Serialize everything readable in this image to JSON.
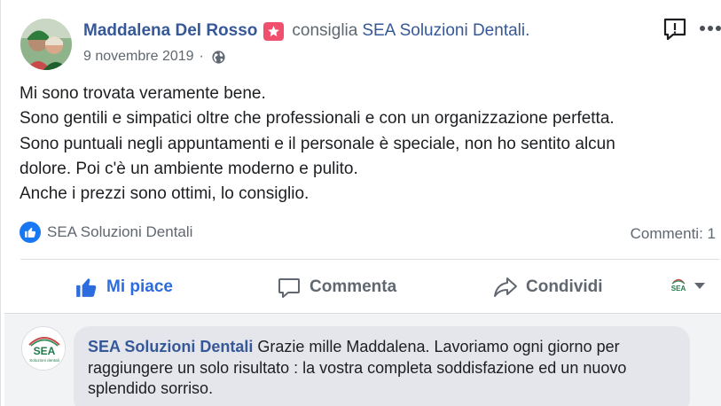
{
  "post": {
    "author": "Maddalena Del Rosso",
    "recommends_text": "consiglia",
    "page_name": "SEA Soluzioni Dentali.",
    "date": "9 novembre 2019",
    "separator": "·",
    "body": [
      "Mi sono trovata veramente bene.",
      "Sono gentili e simpatici oltre che professionali e con un organizzazione perfetta.",
      "Sono puntuali negli appuntamenti e il personale è speciale, non ho sentito alcun",
      "dolore. Poi c'è un ambiente moderno e pulito.",
      "Anche i prezzi sono ottimi, lo consiglio."
    ],
    "likes_by": "SEA Soluzioni Dentali",
    "comments_count": "Commenti: 1"
  },
  "actions": {
    "like": "Mi piace",
    "comment": "Commenta",
    "share": "Condividi"
  },
  "page_selector": {
    "logo_text": "SEA"
  },
  "comment": {
    "avatar_text": "SEA",
    "avatar_subtext": "Soluzioni dentali",
    "author": "SEA Soluzioni Dentali",
    "text": "Grazie mille Maddalena. Lavoriamo ogni giorno per raggiungere un solo risultato : la vostra completa soddisfazione ed un nuovo splendido sorriso."
  },
  "colors": {
    "link": "#365899",
    "like_blue": "#2d6cdf",
    "badge": "#f0506e",
    "sea_green": "#1f7a4a"
  },
  "icons": [
    "star-badge-icon",
    "globe-icon",
    "report-icon",
    "more-icon",
    "like-icon",
    "comment-icon",
    "share-icon",
    "chevron-down-icon"
  ]
}
